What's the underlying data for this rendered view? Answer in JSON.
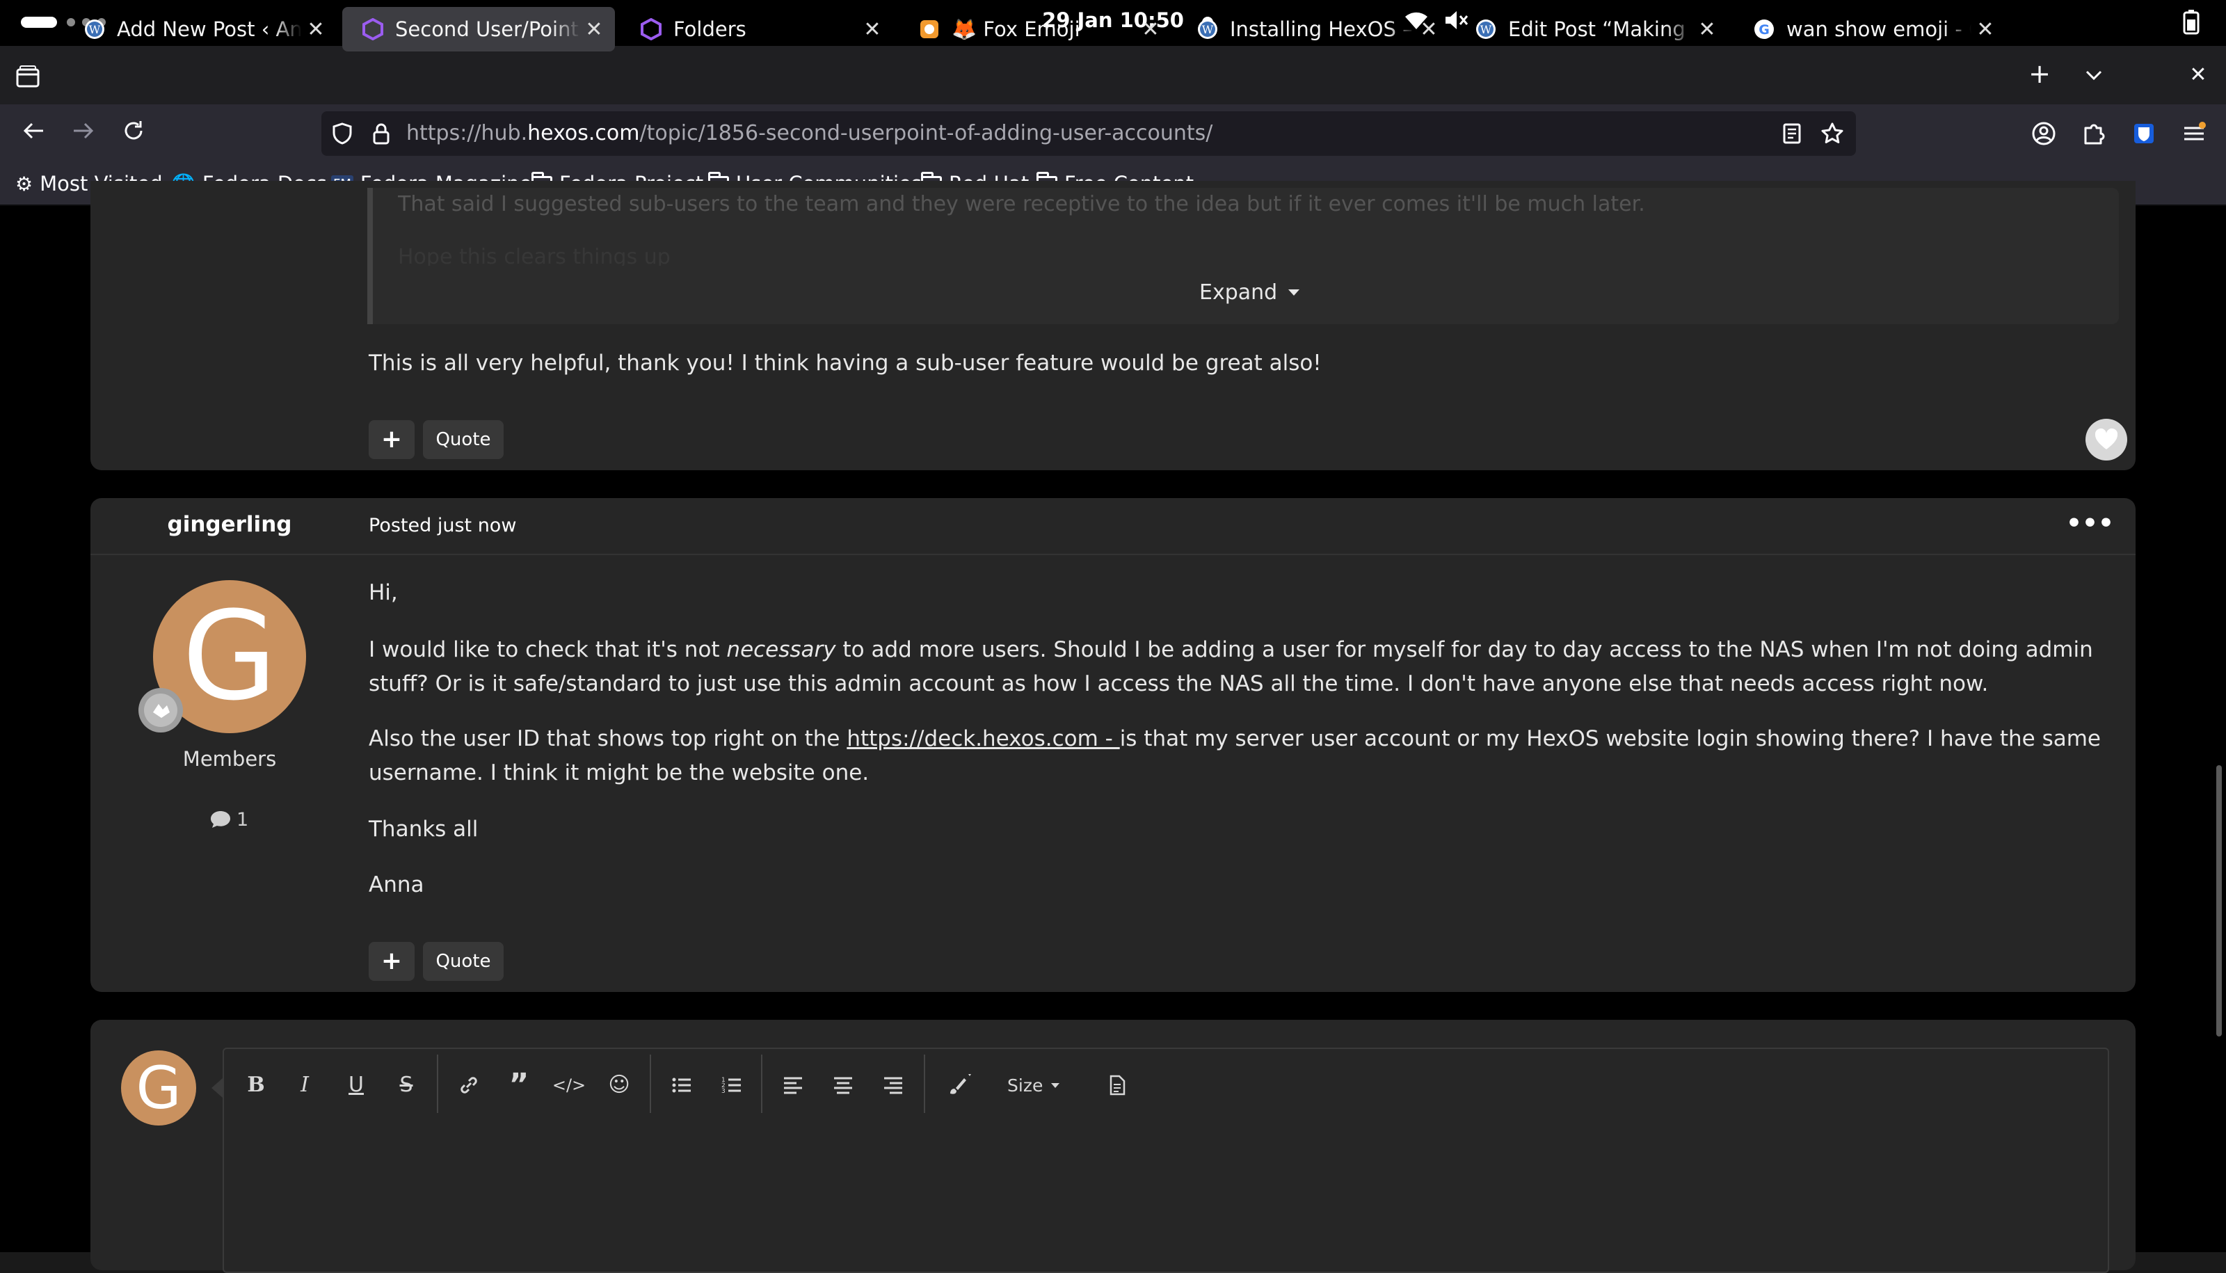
{
  "topbar": {
    "date_time": "29 Jan  10:50"
  },
  "tabs": [
    {
      "title": "Add New Post ‹ Anna",
      "icon": "wordpress-icon",
      "active": false
    },
    {
      "title": "Second User/Point of",
      "icon": "hexos-icon",
      "active": true
    },
    {
      "title": "Folders",
      "icon": "hexos-icon",
      "active": false
    },
    {
      "title": "🦊 Fox Emoji",
      "icon": "emojipedia-icon",
      "active": false
    },
    {
      "title": "Installing HexOS – Ar",
      "icon": "wordpress-icon",
      "active": false
    },
    {
      "title": "Edit Post “Making my",
      "icon": "wordpress-icon",
      "active": false
    },
    {
      "title": "wan show emoji - Go",
      "icon": "google-icon",
      "active": false
    }
  ],
  "navbar": {
    "url_prefix": "https://hub.",
    "url_domain": "hexos.com",
    "url_path": "/topic/1856-second-userpoint-of-adding-user-accounts/"
  },
  "bookmarks": [
    {
      "label": "Most Visited",
      "icon": "gear-icon"
    },
    {
      "label": "Fedora Docs",
      "icon": "globe-icon"
    },
    {
      "label": "Fedora Magazine",
      "icon": "fm-icon"
    },
    {
      "label": "Fedora Project",
      "icon": "folder-icon"
    },
    {
      "label": "User Communities",
      "icon": "folder-icon"
    },
    {
      "label": "Red Hat",
      "icon": "folder-icon"
    },
    {
      "label": "Free Content",
      "icon": "folder-icon"
    }
  ],
  "prev_post": {
    "quote_line1": "That said I suggested sub-users to the team and they were receptive to the idea but if it ever comes it'll be much later.",
    "quote_line2": "Hope this clears things up",
    "expand_label": "Expand",
    "reply_text": "This is all very helpful, thank you! I think having a sub-user feature would be great also!",
    "quote_button": "Quote"
  },
  "post": {
    "author": "gingerling",
    "posted_prefix": "Posted",
    "posted_time": "just now",
    "avatar_letter": "G",
    "role": "Members",
    "post_count": "1",
    "greeting": "Hi,",
    "p1_a": "I would  like to check that it's not ",
    "p1_em": "necessary",
    "p1_b": " to add more users. Should I be adding a user for myself for day to day access to the NAS when I'm not doing admin stuff? Or is it safe/standard to just use this admin account as how I access the NAS all the time. I don't have anyone else that needs access right now.",
    "p2_a": "Also the user ID that shows top right on the ",
    "p2_link": "https://deck.hexos.com  - ",
    "p2_b": "is that my server user account or my HexOS website login showing there? I have the same username. I think it might be the website one.",
    "thanks": "Thanks all",
    "signoff": "Anna",
    "quote_button": "Quote"
  },
  "editor": {
    "avatar_letter": "G",
    "size_label": "Size"
  }
}
